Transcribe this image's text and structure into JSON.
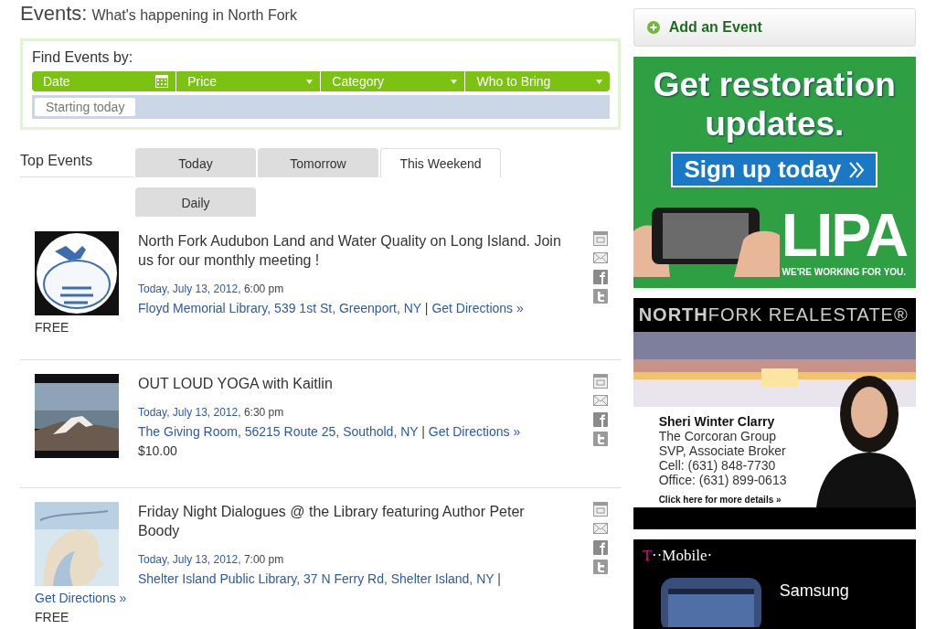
{
  "header": {
    "title": "Events:",
    "subtitle": "What's happening in North Fork"
  },
  "filters": {
    "title": "Find Events by:",
    "fields": [
      {
        "label": "Date",
        "kind": "date"
      },
      {
        "label": "Price",
        "kind": "dropdown"
      },
      {
        "label": "Category",
        "kind": "dropdown"
      },
      {
        "label": "Who to Bring",
        "kind": "dropdown"
      }
    ],
    "chips": [
      "Starting today"
    ]
  },
  "top_events": {
    "label": "Top Events",
    "tabs": [
      {
        "label": "Today",
        "selected": false
      },
      {
        "label": "Tomorrow",
        "selected": false
      },
      {
        "label": "This Weekend",
        "selected": true
      },
      {
        "label": "Daily",
        "selected": false
      }
    ]
  },
  "events": [
    {
      "title": "North Fork Audubon Land and Water Quality on Long Island. Join us for our monthly meeting !",
      "date": "Today, July 13, 2012,",
      "time": "6:00 pm",
      "venue": "Floyd Memorial Library, 539 1st St, Greenport, NY",
      "separator": "|",
      "directions": "Get Directions »",
      "price": "FREE"
    },
    {
      "title": "OUT LOUD YOGA with Kaitlin",
      "date": "Today, July 13, 2012,",
      "time": "6:30 pm",
      "venue": "The Giving Room, 56215 Route 25, Southold, NY",
      "separator": "|",
      "directions": "Get Directions »",
      "price": "$10.00"
    },
    {
      "title": "Friday Night Dialogues @ the Library featuring Author Peter Boody",
      "date": "Today, July 13, 2012,",
      "time": "7:00 pm",
      "venue": "Shelter Island Public Library, 37 N Ferry Rd, Shelter Island, NY",
      "separator": "|",
      "directions": "Get Directions »",
      "price": "FREE"
    }
  ],
  "sidebar": {
    "add_button": "Add an Event",
    "ads": [
      {
        "kind": "lipa",
        "headline": "Get restoration updates.",
        "button": "Sign up today",
        "logo": "LIPA",
        "tagline": "WE'RE WORKING FOR YOU."
      },
      {
        "kind": "realestate",
        "brand": "**NORTH**FORK REALESTATE®",
        "lines": [
          "Sheri Winter Clarry",
          "The Corcoran Group",
          "SVP, Associate Broker",
          "Cell: (631) 848-7730",
          "Office: (631) 899-0613"
        ],
        "link": "Click here for more details »"
      },
      {
        "kind": "tmobile",
        "logo_mark": "T",
        "logo_text": "··Mobile·",
        "product": "Samsung"
      }
    ]
  }
}
